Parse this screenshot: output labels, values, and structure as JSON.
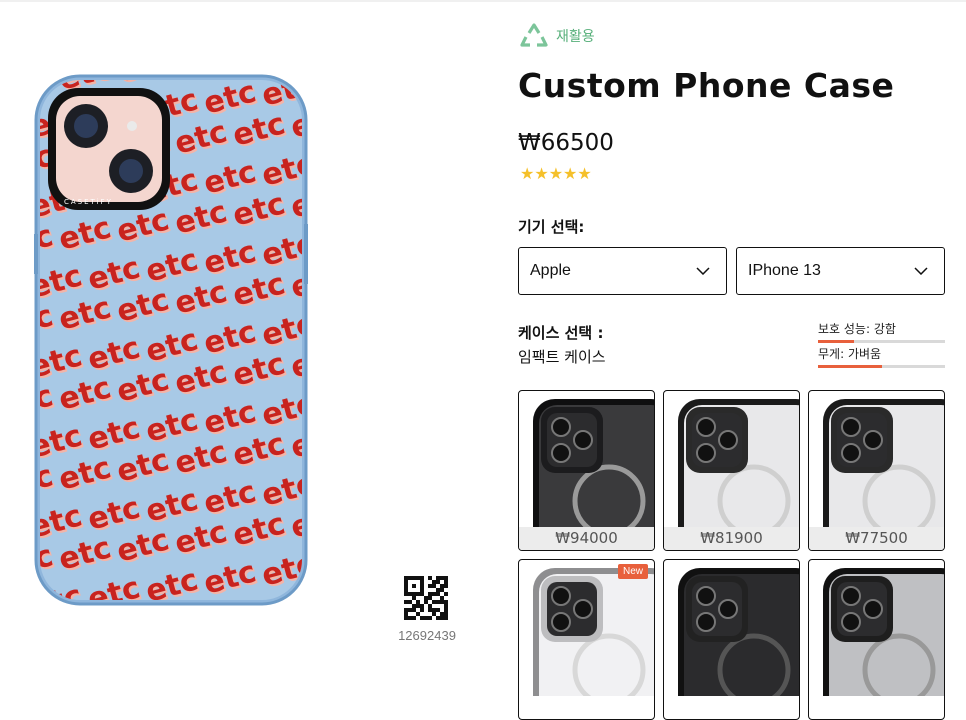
{
  "product": {
    "eco_label": "재활용",
    "title": "Custom Phone Case",
    "price": "₩66500",
    "rating": 5,
    "stars": "★★★★★",
    "pattern_text": "etc",
    "brand_text": "CASETiFY",
    "qr_code_number": "12692439"
  },
  "selection": {
    "device_label": "기기 선택:",
    "brand": "Apple",
    "model": "IPhone 13",
    "case_label": "케이스 선택 :",
    "case_value": "임팩트 케이스"
  },
  "specs": [
    {
      "label": "보호 성능: 강함",
      "level": 0.28
    },
    {
      "label": "무게: 가벼움",
      "level": 0.5
    }
  ],
  "cases": [
    {
      "price": "₩94000",
      "badge": "",
      "style": "black"
    },
    {
      "price": "₩81900",
      "badge": "",
      "style": "clear-black"
    },
    {
      "price": "₩77500",
      "badge": "",
      "style": "clear-black"
    },
    {
      "price": "",
      "badge": "New",
      "style": "clear-silver"
    },
    {
      "price": "",
      "badge": "",
      "style": "leather-black"
    },
    {
      "price": "",
      "badge": "",
      "style": "mirror"
    }
  ],
  "colors": {
    "accent": "#e8603c",
    "eco_green": "#58b07b",
    "star": "#f5c02a",
    "case_blue": "#a8c9e6",
    "pattern_red": "#c8231e"
  }
}
